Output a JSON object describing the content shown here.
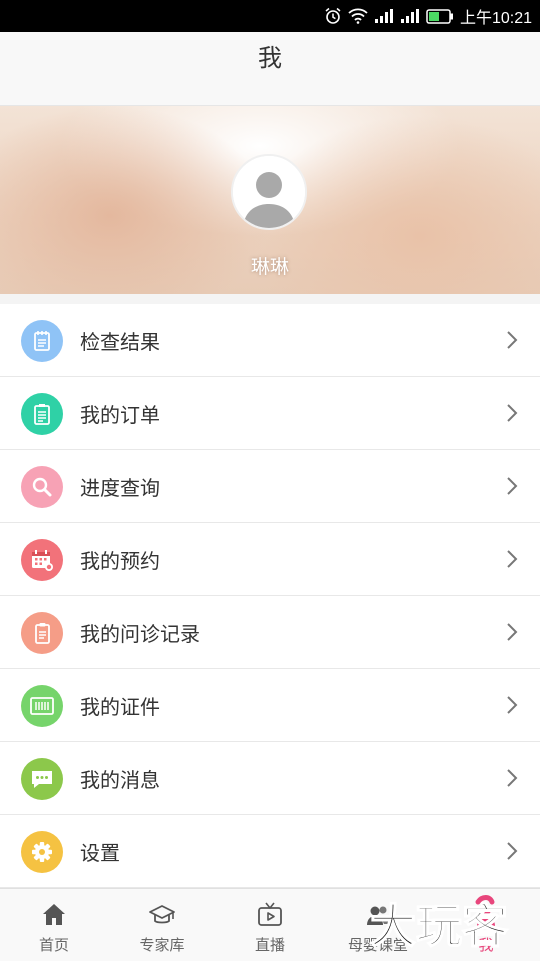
{
  "status_bar": {
    "time": "上午10:21"
  },
  "header": {
    "title": "我"
  },
  "profile": {
    "username": "琳琳"
  },
  "menu": [
    {
      "label": "检查结果",
      "icon": "document-icon",
      "color": "#8fc3f6"
    },
    {
      "label": "我的订单",
      "icon": "clipboard-list-icon",
      "color": "#2fd1a6"
    },
    {
      "label": "进度查询",
      "icon": "search-icon",
      "color": "#f7a2b5"
    },
    {
      "label": "我的预约",
      "icon": "calendar-icon",
      "color": "#f2727a"
    },
    {
      "label": "我的问诊记录",
      "icon": "record-icon",
      "color": "#f59d87"
    },
    {
      "label": "我的证件",
      "icon": "id-card-icon",
      "color": "#76d46b"
    },
    {
      "label": "我的消息",
      "icon": "message-icon",
      "color": "#8cc84b"
    },
    {
      "label": "设置",
      "icon": "gear-icon",
      "color": "#f5c242"
    }
  ],
  "bottom_nav": [
    {
      "label": "首页",
      "icon": "home-icon"
    },
    {
      "label": "专家库",
      "icon": "graduation-cap-icon"
    },
    {
      "label": "直播",
      "icon": "tv-play-icon"
    },
    {
      "label": "母婴课堂",
      "icon": "classroom-icon"
    },
    {
      "label": "我",
      "icon": "profile-icon",
      "active": true
    }
  ],
  "watermark": {
    "text": "大玩客"
  },
  "colors": {
    "accent": "#e8467c",
    "header_bg": "#f8f8f8"
  }
}
